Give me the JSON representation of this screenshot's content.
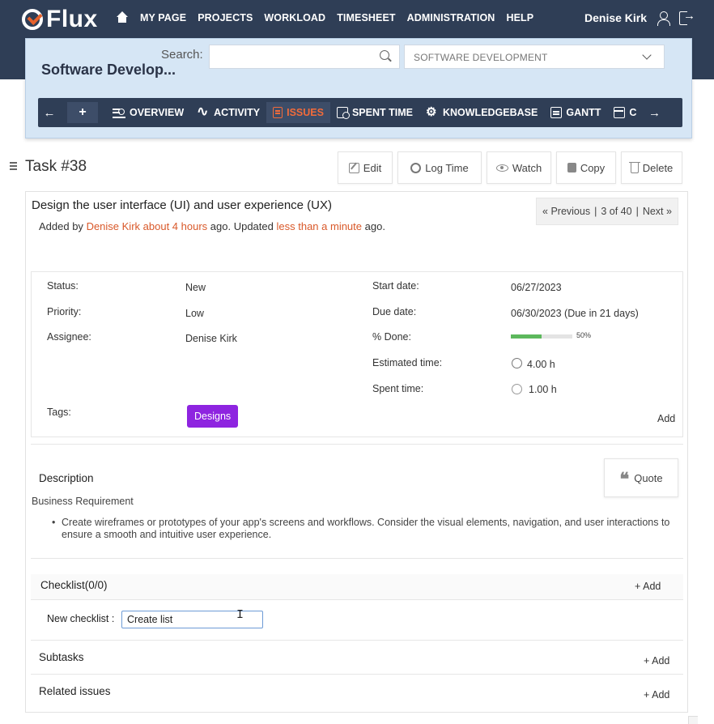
{
  "app": {
    "name": "Flux"
  },
  "topnav": {
    "links": [
      "MY PAGE",
      "PROJECTS",
      "WORKLOAD",
      "TIMESHEET",
      "ADMINISTRATION",
      "HELP"
    ],
    "user_name": "Denise Kirk"
  },
  "project": {
    "title": "Software Develop...",
    "search_label": "Search:",
    "search_value": "",
    "selected_project": "SOFTWARE DEVELOPMENT"
  },
  "menu": {
    "left_arrow": "←",
    "right_arrow": "→",
    "add_label": "+",
    "items": [
      {
        "label": "OVERVIEW",
        "icon": "overview-icon"
      },
      {
        "label": "ACTIVITY",
        "icon": "activity-icon"
      },
      {
        "label": "ISSUES",
        "icon": "issues-icon",
        "active": true
      },
      {
        "label": "SPENT TIME",
        "icon": "spent-time-icon"
      },
      {
        "label": "KNOWLEDGEBASE",
        "icon": "knowledgebase-icon"
      },
      {
        "label": "GANTT",
        "icon": "gantt-icon"
      },
      {
        "label": "C",
        "icon": "calendar-icon"
      }
    ]
  },
  "task": {
    "title": "Task #38",
    "actions": {
      "edit": "Edit",
      "log_time": "Log Time",
      "watch": "Watch",
      "copy": "Copy",
      "delete": "Delete"
    },
    "subject": "Design the user interface (UI) and user experience (UX)",
    "meta": {
      "added_by": "Added by",
      "author": "Denise Kirk",
      "created_ago": "about 4 hours",
      "updated_text": "ago. Updated",
      "updated_ago": "less than a minute",
      "ago": "ago."
    },
    "pager": {
      "previous": "« Previous",
      "sep1": "|",
      "position": "3 of 40",
      "sep2": "|",
      "next": "Next »"
    },
    "attributes": {
      "status_label": "Status:",
      "status": "New",
      "priority_label": "Priority:",
      "priority": "Low",
      "assignee_label": "Assignee:",
      "assignee": "Denise Kirk",
      "start_label": "Start date:",
      "start": "06/27/2023",
      "due_label": "Due date:",
      "due": "06/30/2023 (Due in 21 days)",
      "done_label": "% Done:",
      "done_text": "50%",
      "done_fraction": 0.5,
      "estimated_label": "Estimated time:",
      "estimated": "4.00 h",
      "spent_label": "Spent time:",
      "spent": "1.00 h",
      "tags_label": "Tags:",
      "tag": "Designs",
      "tags_add": "Add"
    },
    "description": {
      "title": "Description",
      "quote_label": "Quote",
      "heading": "Business Requirement",
      "bullet": "Create wireframes or prototypes of your app's screens and workflows. Consider the visual elements, navigation, and user interactions to ensure a smooth and intuitive user experience."
    },
    "checklist": {
      "title": "Checklist(0/0)",
      "add_label": "Add",
      "new_label": "New checklist :",
      "new_value": "Create list"
    },
    "subtasks": {
      "title": "Subtasks",
      "add_label": "Add"
    },
    "related": {
      "title": "Related issues",
      "add_label": "Add"
    }
  },
  "colors": {
    "nav": "#2f3e56",
    "accent": "#f26b3a",
    "link": "#d9592a",
    "tag": "#8e24e0",
    "progress": "#5cb85c"
  }
}
